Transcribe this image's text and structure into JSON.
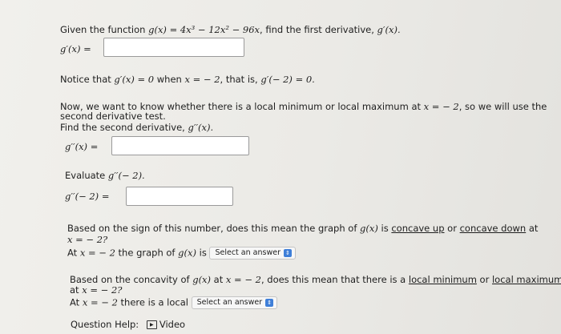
{
  "q1": {
    "prefix": "Given the function ",
    "function": "g(x) = 4x³ − 12x² − 96x",
    "suffix": ", find the first derivative, ",
    "target": "g′(x).",
    "answer_label": "g′(x) ="
  },
  "notice": {
    "prefix": "Notice that ",
    "eq1": "g′(x) = 0",
    "mid": " when ",
    "eq2": "x = − 2",
    "mid2": ", that is, ",
    "eq3": "g′(− 2) = 0."
  },
  "q2": {
    "line1_prefix": "Now, we want to know whether there is a local minimum or local maximum at ",
    "line1_eq": "x = − 2",
    "line1_suffix": ", so we will use the",
    "line2": "second derivative test.",
    "line3_prefix": "Find the second derivative, ",
    "line3_eq": "g′′(x).",
    "answer_label": "g′′(x) ="
  },
  "q3": {
    "prefix": "Evaluate ",
    "eq": "g′′(− 2).",
    "answer_label": "g′′(− 2) ="
  },
  "q4": {
    "line1_prefix": "Based on the sign of this number, does this mean the graph of ",
    "line1_fn": "g(x)",
    "line1_mid": " is ",
    "concave_up": "concave up",
    "or": " or ",
    "concave_down": "concave down",
    "at": " at",
    "line2_eq": "x = − 2?",
    "line3_prefix": "At ",
    "line3_eq": "x = − 2",
    "line3_mid": " the graph of ",
    "line3_fn": "g(x)",
    "line3_is": " is ",
    "select_label": "Select an answer"
  },
  "q5": {
    "line1_prefix": "Based on the concavity of ",
    "line1_fn": "g(x)",
    "line1_at": " at ",
    "line1_eq": "x = − 2",
    "line1_mid": ", does this mean that there is a ",
    "local_min": "local minimum",
    "or": " or ",
    "local_max": "local maximum",
    "line2_prefix": "at ",
    "line2_eq": "x = − 2?",
    "line3_prefix": "At ",
    "line3_eq": "x = − 2",
    "line3_mid": " there is a local ",
    "select_label": "Select an answer"
  },
  "help": {
    "label": "Question Help:",
    "video_label": "Video"
  },
  "icons": {
    "chevron": "up-down-chevron-icon",
    "video": "video-play-icon"
  },
  "colors": {
    "accent": "#3f7fd8"
  }
}
